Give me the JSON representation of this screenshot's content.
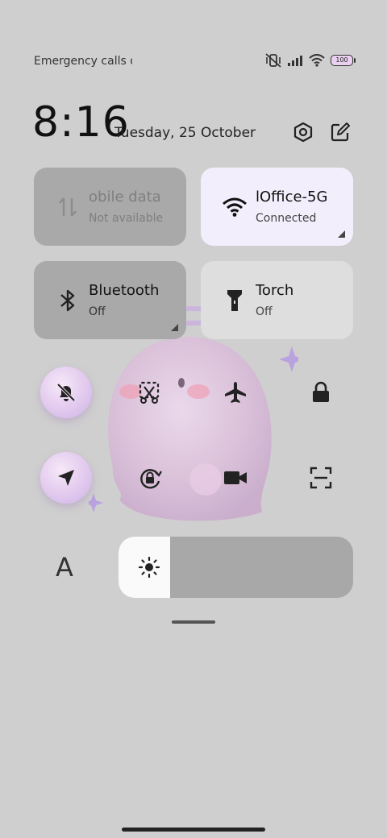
{
  "status": {
    "text": "Emergency calls o",
    "battery": "100"
  },
  "header": {
    "time": "8:16",
    "date": "Tuesday, 25 October"
  },
  "tiles": {
    "mobile_data": {
      "title": "obile data",
      "subtitle": "Not available"
    },
    "wifi": {
      "title": "lOffice-5G",
      "subtitle": "Connected"
    },
    "bluetooth": {
      "title": "Bluetooth",
      "subtitle": "Off"
    },
    "torch": {
      "title": "Torch",
      "subtitle": "Off"
    }
  },
  "font_button": {
    "label": "A"
  },
  "brightness": {
    "level_percent": 22
  },
  "colors": {
    "wifi_tile": "#f3eefc",
    "disabled_tile": "#a9a9a9",
    "inactive_tile": "#dedede",
    "active_round": "#e2c9ee"
  },
  "icons": [
    "mute-bell-icon",
    "screenshot-cut-icon",
    "airplane-icon",
    "lock-icon",
    "location-icon",
    "rotation-lock-icon",
    "video-camera-icon",
    "scan-icon",
    "settings-icon",
    "edit-icon",
    "sun-icon"
  ]
}
